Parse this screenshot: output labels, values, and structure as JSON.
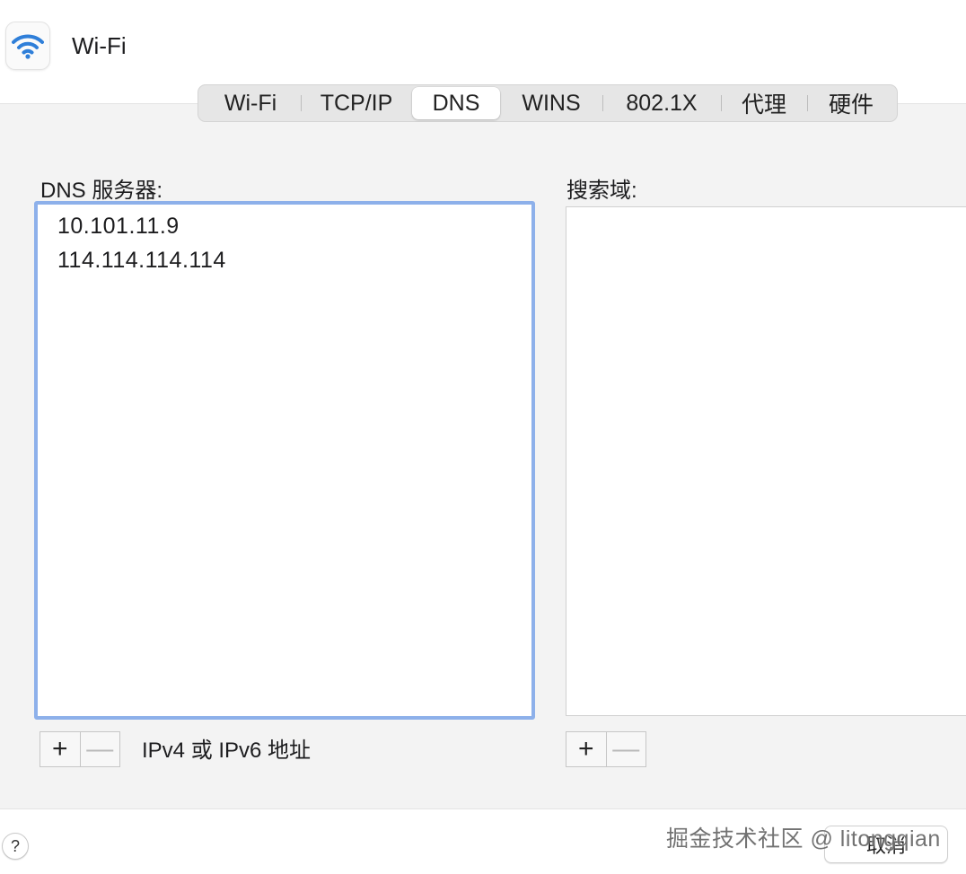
{
  "window": {
    "title": "Wi-Fi",
    "icon": "wifi-icon"
  },
  "tabs": [
    {
      "label": "Wi-Fi",
      "active": false
    },
    {
      "label": "TCP/IP",
      "active": false
    },
    {
      "label": "DNS",
      "active": true
    },
    {
      "label": "WINS",
      "active": false
    },
    {
      "label": "802.1X",
      "active": false
    },
    {
      "label": "代理",
      "active": false
    },
    {
      "label": "硬件",
      "active": false
    }
  ],
  "dns": {
    "label": "DNS 服务器:",
    "servers": [
      "10.101.11.9",
      "114.114.114.114"
    ],
    "add_label": "+",
    "remove_label": "—",
    "hint": "IPv4 或 IPv6 地址"
  },
  "search_domains": {
    "label": "搜索域:",
    "items": [],
    "add_label": "+",
    "remove_label": "—"
  },
  "footer": {
    "help_label": "?",
    "cancel_label": "取消",
    "watermark": "掘金技术社区 @ litongqian"
  },
  "colors": {
    "focus_ring": "#8db0ea",
    "wifi_blue": "#2f7fd9"
  }
}
